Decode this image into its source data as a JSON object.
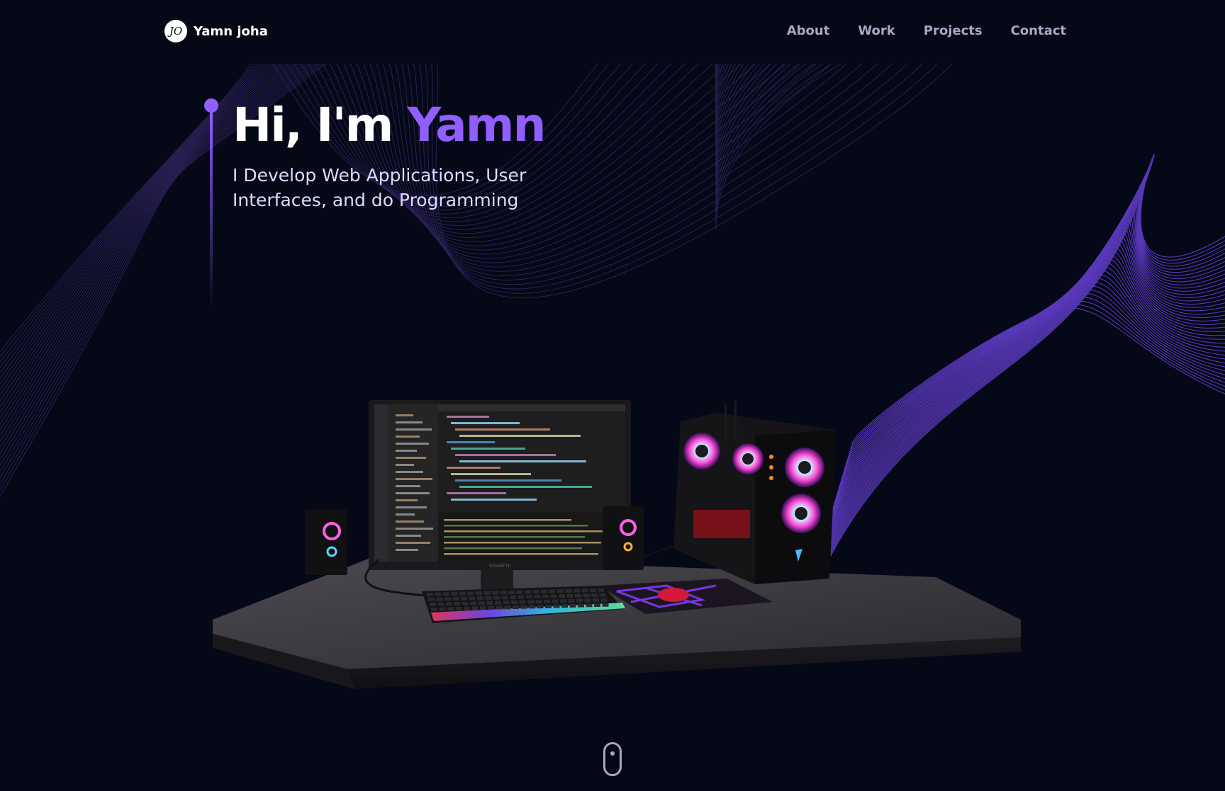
{
  "colors": {
    "background": "#050816",
    "accent": "#915eff",
    "nav_text": "#aaa6c3",
    "subtitle": "#dfd9ff"
  },
  "brand": {
    "monogram": "JO",
    "name": "Yamn joha"
  },
  "nav": {
    "links": [
      "About",
      "Work",
      "Projects",
      "Contact"
    ]
  },
  "hero": {
    "greeting": "Hi, I'm",
    "name": "Yamn",
    "subtitle": "I Develop Web Applications, User Interfaces, and do Programming"
  },
  "scene": {
    "monitor_brand": "GIGABYTE"
  },
  "icons": {
    "logo": "monogram-badge-icon",
    "scroll": "mouse-scroll-icon"
  }
}
